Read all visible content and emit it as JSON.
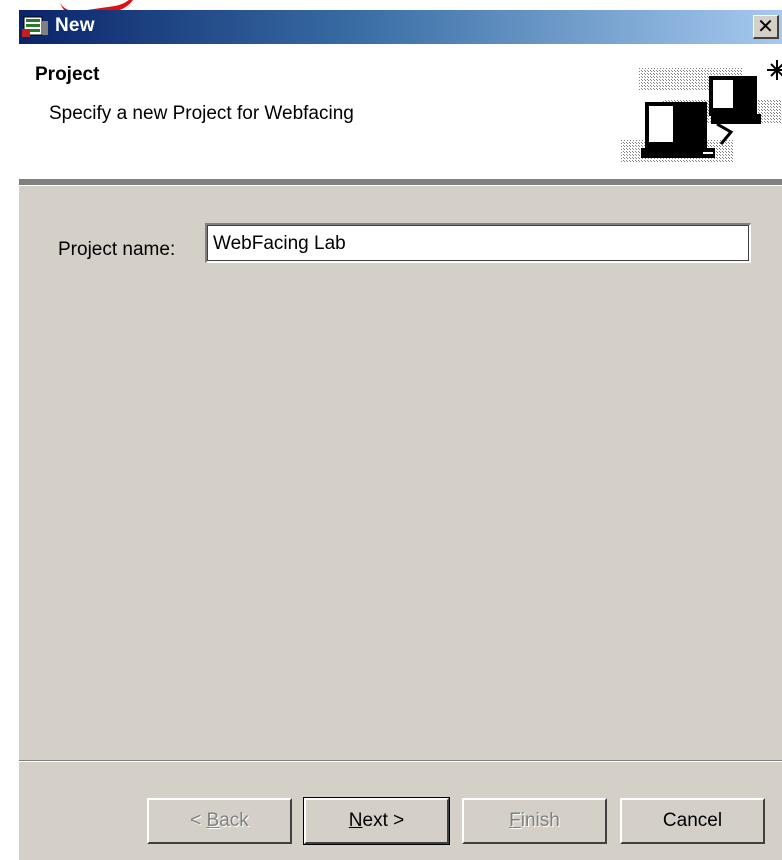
{
  "window": {
    "title": "New",
    "close_symbol": "✕"
  },
  "header": {
    "title": "Project",
    "description": "Specify a new Project for Webfacing"
  },
  "form": {
    "project_name_label": "Project name:",
    "project_name_value": "WebFacing Lab"
  },
  "buttons": {
    "back": {
      "prefix": "< ",
      "mnemonic": "B",
      "rest": "ack",
      "enabled": false
    },
    "next": {
      "mnemonic": "N",
      "rest": "ext >",
      "enabled": true
    },
    "finish": {
      "mnemonic": "F",
      "rest": "inish",
      "enabled": false
    },
    "cancel": {
      "label": "Cancel",
      "enabled": true
    }
  },
  "icons": {
    "app": "wizard-app-icon",
    "banner": "computer-network-icon",
    "close": "close-icon"
  },
  "colors": {
    "title_start": "#0a246a",
    "title_end": "#a6caf0",
    "dialog_bg": "#d4d0c8",
    "annotation": "#e01010"
  }
}
